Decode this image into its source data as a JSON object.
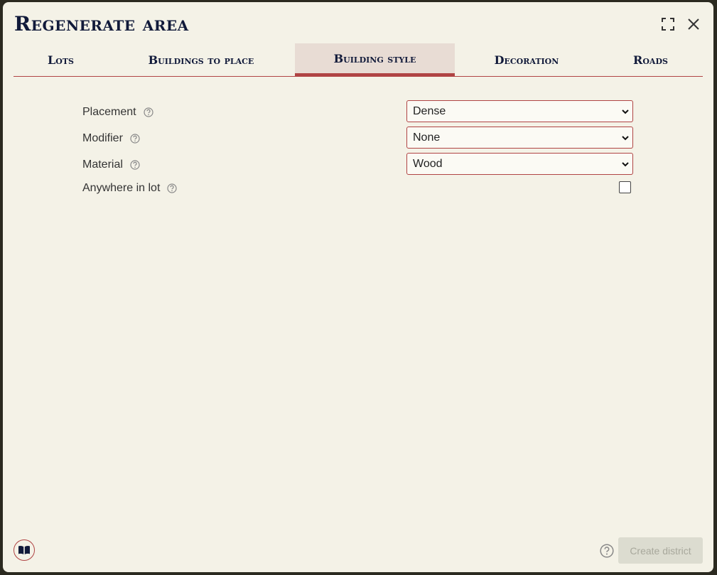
{
  "dialog": {
    "title": "Regenerate area"
  },
  "tabs": [
    {
      "label": "Lots"
    },
    {
      "label": "Buildings to place"
    },
    {
      "label": "Building style"
    },
    {
      "label": "Decoration"
    },
    {
      "label": "Roads"
    }
  ],
  "active_tab": "Building style",
  "form": {
    "placement": {
      "label": "Placement",
      "value": "Dense"
    },
    "modifier": {
      "label": "Modifier",
      "value": "None"
    },
    "material": {
      "label": "Material",
      "value": "Wood"
    },
    "anywhere_in_lot": {
      "label": "Anywhere in lot",
      "checked": false
    }
  },
  "footer": {
    "create_label": "Create district"
  },
  "colors": {
    "accent": "#b04444",
    "title": "#111a3a",
    "background": "#f4f2e7",
    "active_tab_bg": "#e8dcd4"
  },
  "icons": {
    "maximize": "maximize-icon",
    "close": "close-icon",
    "help": "help-circle-icon",
    "chevron": "chevron-down-icon",
    "book": "book-icon"
  }
}
